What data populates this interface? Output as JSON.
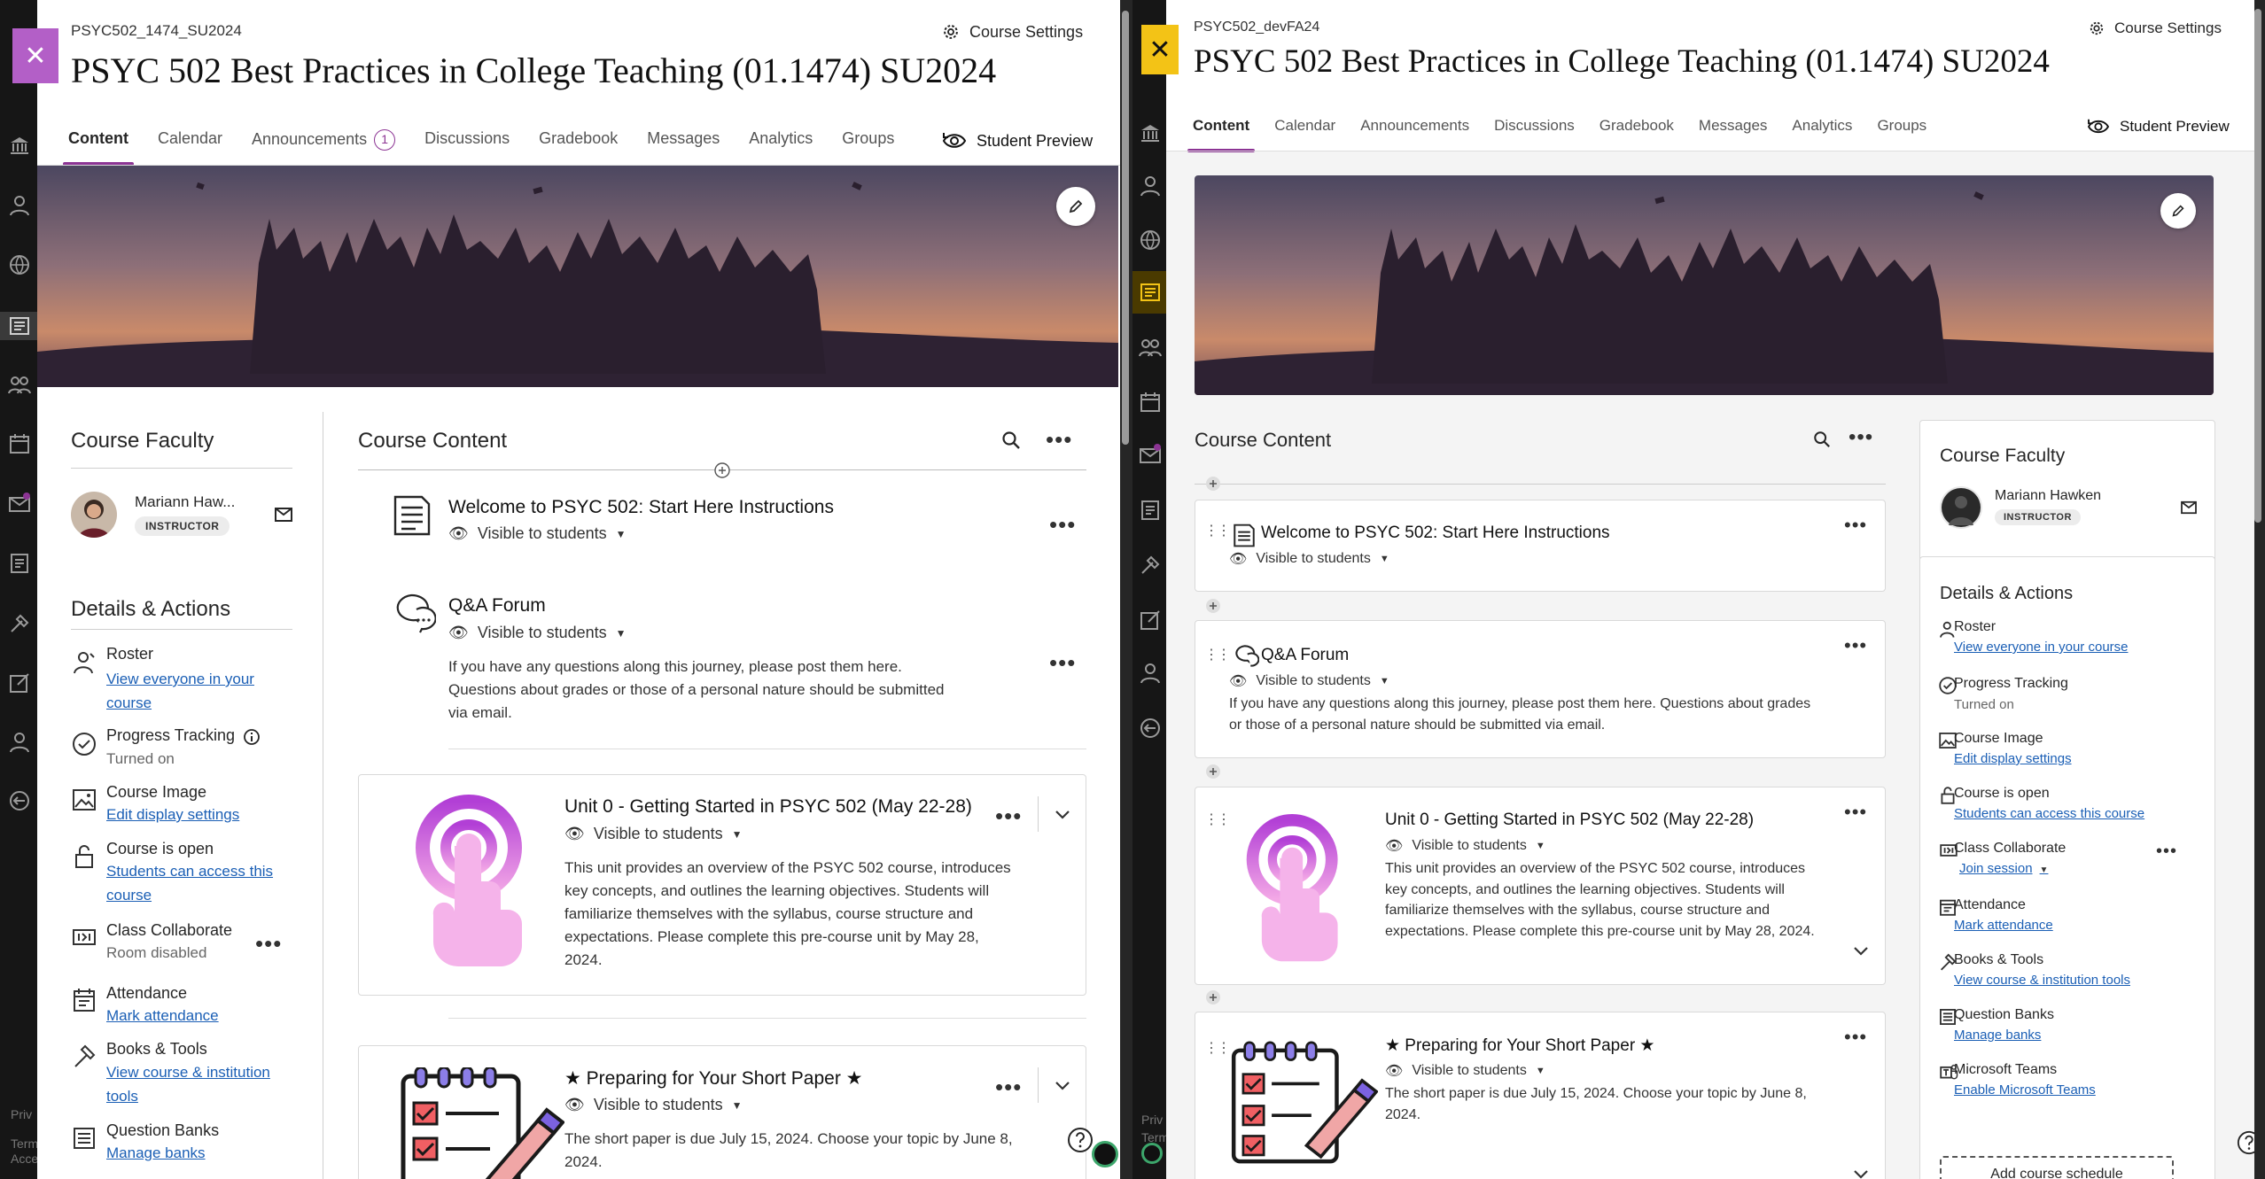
{
  "left": {
    "course_code": "PSYC502_1474_SU2024",
    "course_title": "PSYC 502 Best Practices in College Teaching (01.1474) SU2024",
    "settings_label": "Course Settings",
    "tabs": [
      "Content",
      "Calendar",
      "Announcements",
      "Discussions",
      "Gradebook",
      "Messages",
      "Analytics",
      "Groups"
    ],
    "announcement_count": "1",
    "student_preview": "Student Preview",
    "faculty_heading": "Course Faculty",
    "instructor_name": "Mariann Haw...",
    "instructor_role": "INSTRUCTOR",
    "details_heading": "Details & Actions",
    "roster": {
      "label": "Roster",
      "link1": "View everyone in your",
      "link2": "course"
    },
    "progress": {
      "label": "Progress Tracking",
      "status": "Turned on"
    },
    "image": {
      "label": "Course Image",
      "link": "Edit display settings"
    },
    "open": {
      "label": "Course is open",
      "link1": "Students can access this",
      "link2": "course"
    },
    "collab": {
      "label": "Class Collaborate",
      "status": "Room disabled"
    },
    "attendance": {
      "label": "Attendance",
      "link": "Mark attendance"
    },
    "books": {
      "label": "Books & Tools",
      "link1": "View course & institution",
      "link2": "tools"
    },
    "qbanks": {
      "label": "Question Banks",
      "link": "Manage banks"
    },
    "content_heading": "Course Content",
    "items": [
      {
        "title": "Welcome to PSYC 502: Start Here Instructions",
        "visibility": "Visible to students"
      },
      {
        "title": "Q&A Forum",
        "visibility": "Visible to students",
        "desc1": "If you have any questions along this journey, please post them here.",
        "desc2": "Questions about grades or those of a personal nature should be submitted",
        "desc3": "via email."
      },
      {
        "title": "Unit 0 - Getting Started in PSYC 502 (May 22-28)",
        "visibility": "Visible to students",
        "desc1": "This unit provides an overview of the PSYC 502 course, introduces",
        "desc2": "key concepts, and outlines the learning objectives. Students will",
        "desc3": "familiarize themselves with the syllabus, course structure and",
        "desc4": "expectations. Please complete this pre-course unit by May 28,",
        "desc5": "2024."
      },
      {
        "title": "★ Preparing for Your Short Paper ★",
        "visibility": "Visible to students",
        "desc1": "The short paper is due July 15, 2024. Choose your topic by June 8,",
        "desc2": "2024."
      }
    ],
    "footer1": "Priv",
    "footer2": "Term",
    "footer3": "Acce"
  },
  "right": {
    "course_code": "PSYC502_devFA24",
    "course_title": "PSYC 502 Best Practices in College Teaching (01.1474) SU2024",
    "settings_label": "Course Settings",
    "tabs": [
      "Content",
      "Calendar",
      "Announcements",
      "Discussions",
      "Gradebook",
      "Messages",
      "Analytics",
      "Groups"
    ],
    "student_preview": "Student Preview",
    "content_heading": "Course Content",
    "items": [
      {
        "title": "Welcome to PSYC 502: Start Here Instructions",
        "visibility": "Visible to students"
      },
      {
        "title": "Q&A Forum",
        "visibility": "Visible to students",
        "desc1": "If you have any questions along this journey, please post them here. Questions about grades",
        "desc2": "or those of a personal nature should be submitted via email."
      },
      {
        "title": "Unit 0 - Getting Started in PSYC 502 (May 22-28)",
        "visibility": "Visible to students",
        "desc1": "This unit provides an overview of the PSYC 502 course, introduces",
        "desc2": "key concepts, and outlines the learning objectives. Students will",
        "desc3": "familiarize themselves with the syllabus, course structure and",
        "desc4": "expectations. Please complete this pre-course unit by May 28, 2024."
      },
      {
        "title": "★ Preparing for Your Short Paper ★",
        "visibility": "Visible to students",
        "desc1": "The short paper is due July 15, 2024. Choose your topic by June 8,",
        "desc2": "2024."
      }
    ],
    "faculty_heading": "Course Faculty",
    "instructor_name": "Mariann Hawken",
    "instructor_role": "INSTRUCTOR",
    "details_heading": "Details & Actions",
    "roster": {
      "label": "Roster",
      "link": "View everyone in your course"
    },
    "progress": {
      "label": "Progress Tracking",
      "status": "Turned on"
    },
    "image": {
      "label": "Course Image",
      "link": "Edit display settings"
    },
    "open": {
      "label": "Course is open",
      "link": "Students can access this course"
    },
    "collab": {
      "label": "Class Collaborate",
      "link": "Join session"
    },
    "attendance": {
      "label": "Attendance",
      "link": "Mark attendance"
    },
    "books": {
      "label": "Books & Tools",
      "link": "View course & institution tools"
    },
    "qbanks": {
      "label": "Question Banks",
      "link": "Manage banks"
    },
    "teams": {
      "label": "Microsoft Teams",
      "link": "Enable Microsoft Teams"
    },
    "add_schedule": "Add course schedule",
    "footer1": "Priv",
    "footer2": "Term"
  },
  "colors": {
    "accent": "#8c3494",
    "left_close": "#b35fc7",
    "right_close": "#f3c316",
    "link": "#1b5fb5"
  }
}
